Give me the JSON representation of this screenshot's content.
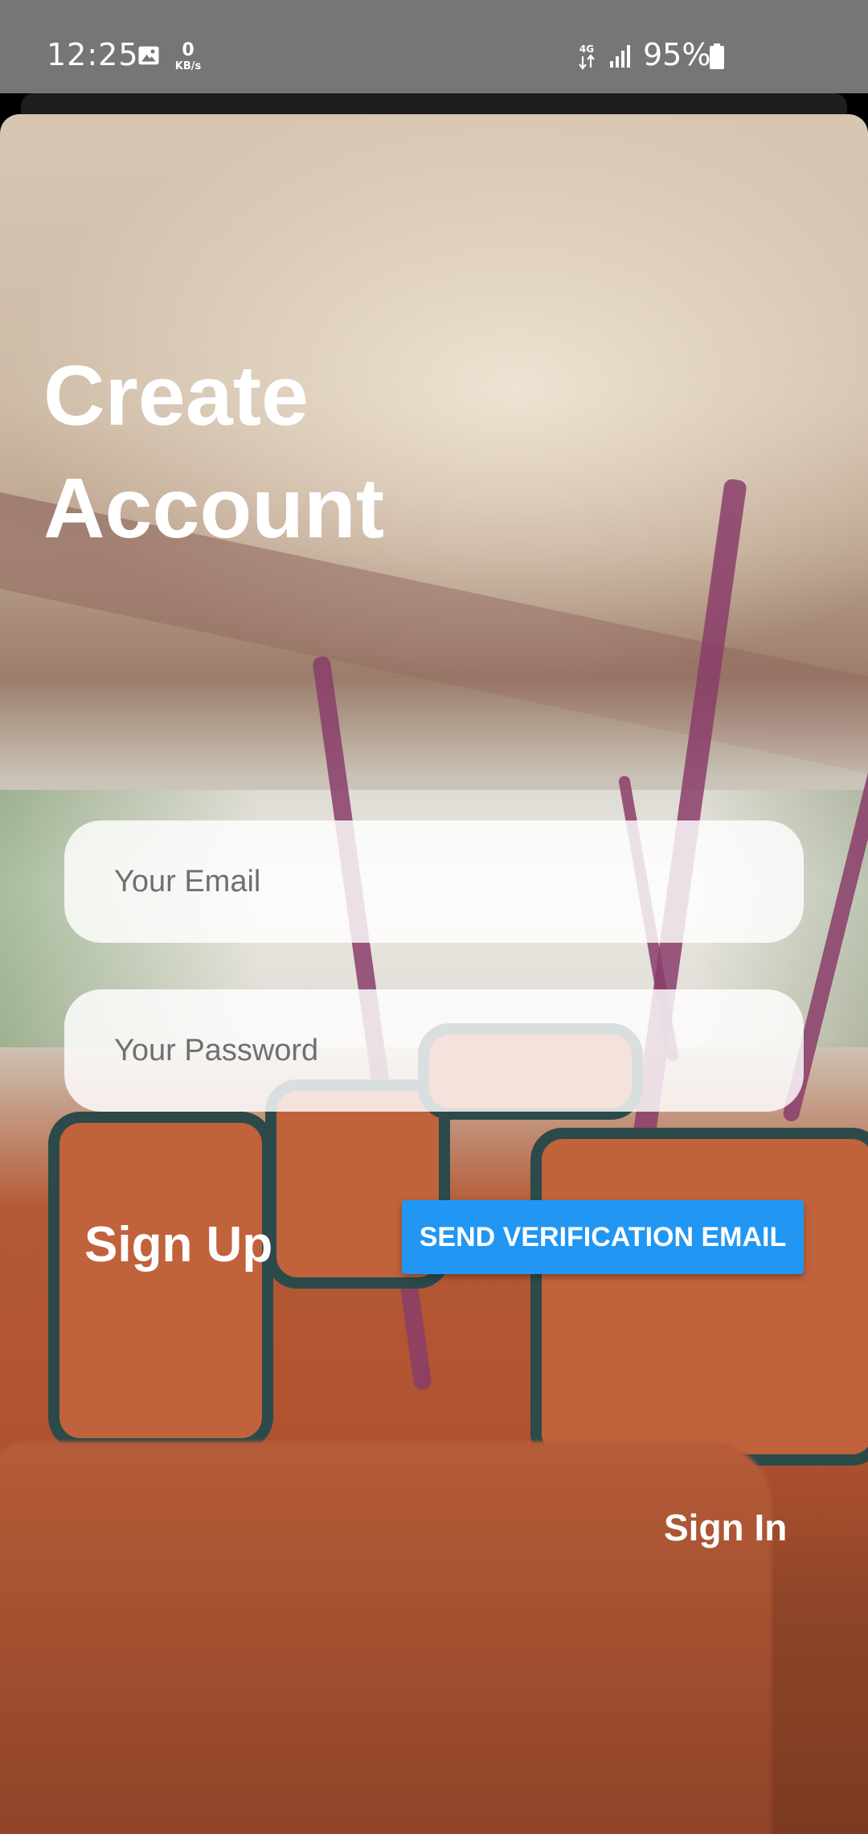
{
  "status_bar": {
    "time": "12:25",
    "net_speed_value": "0",
    "net_speed_unit": "KB/s",
    "network_type": "4G",
    "battery_percent": "95%",
    "icons": [
      "image-icon",
      "network-4g-icon",
      "signal-icon",
      "battery-icon"
    ]
  },
  "page": {
    "title_line1": "Create",
    "title_line2": "Account"
  },
  "form": {
    "email_placeholder": "Your Email",
    "email_value": "",
    "password_placeholder": "Your Password",
    "password_value": ""
  },
  "actions": {
    "signup_label": "Sign Up",
    "send_verification_label": "SEND VERIFICATION EMAIL",
    "signin_label": "Sign In"
  },
  "colors": {
    "status_bar_bg": "#767676",
    "primary_button": "#2196f3",
    "input_bg": "rgba(255,255,255,0.82)",
    "text_on_image": "#ffffff"
  }
}
